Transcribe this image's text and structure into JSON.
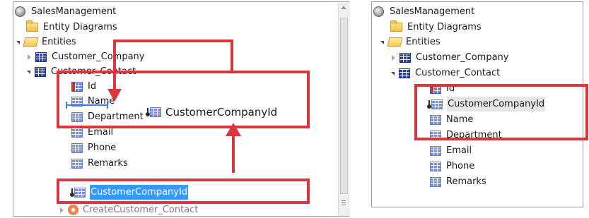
{
  "left_tree": {
    "root": "SalesManagement",
    "entity_diagrams": "Entity Diagrams",
    "entities": "Entities",
    "customer_company": "Customer_Company",
    "customer_contact": "Customer_Contact",
    "id": "Id",
    "name": "Name",
    "department": "Department",
    "email": "Email",
    "phone": "Phone",
    "remarks": "Remarks",
    "customer_company_id": "CustomerCompanyId",
    "create_action": "CreateCustomer_Contact",
    "drag_label": "CustomerCompanyId"
  },
  "right_tree": {
    "root": "SalesManagement",
    "entity_diagrams": "Entity Diagrams",
    "entities": "Entities",
    "customer_company": "Customer_Company",
    "customer_contact": "Customer_Contact",
    "id": "Id",
    "customer_company_id": "CustomerCompanyId",
    "name": "Name",
    "department": "Department",
    "email": "Email",
    "phone": "Phone",
    "remarks": "Remarks"
  },
  "colors": {
    "annotation_red": "#d9363e",
    "selection_blue": "#3399ff"
  }
}
